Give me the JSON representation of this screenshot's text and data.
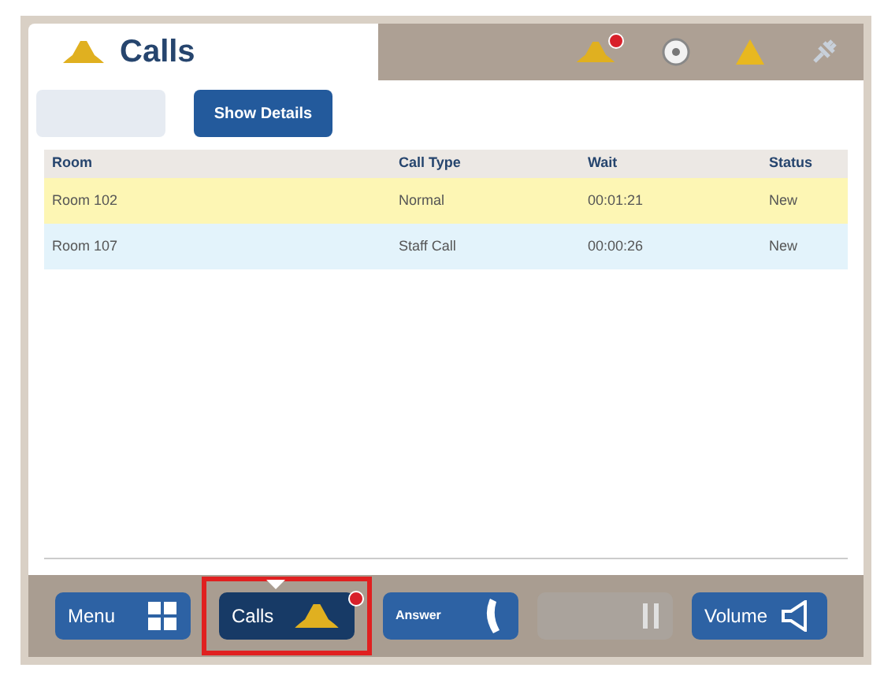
{
  "title": "Calls",
  "action_buttons": [
    {
      "disabled": true
    },
    {
      "label": "Show Details",
      "disabled": false
    }
  ],
  "table": {
    "columns": [
      "Room",
      "Call Type",
      "Wait",
      "Status"
    ],
    "rows": [
      {
        "cells": [
          "Room 102",
          "Normal",
          "00:01:21",
          "New"
        ],
        "selected": true
      },
      {
        "cells": [
          "Room 107",
          "Staff Call",
          "00:00:26",
          "New"
        ],
        "selected": false
      }
    ]
  },
  "toolbar": [
    {
      "kind": "menu",
      "label": "Menu",
      "selected": false,
      "disabled": false
    },
    {
      "kind": "calls",
      "label": "Calls",
      "selected": true,
      "disabled": false
    },
    {
      "kind": "answer",
      "label": "Answer",
      "selected": false,
      "disabled": false
    },
    {
      "kind": "hold",
      "selected": false,
      "disabled": true
    },
    {
      "kind": "volume",
      "label": "Volume",
      "selected": false,
      "disabled": false
    }
  ]
}
